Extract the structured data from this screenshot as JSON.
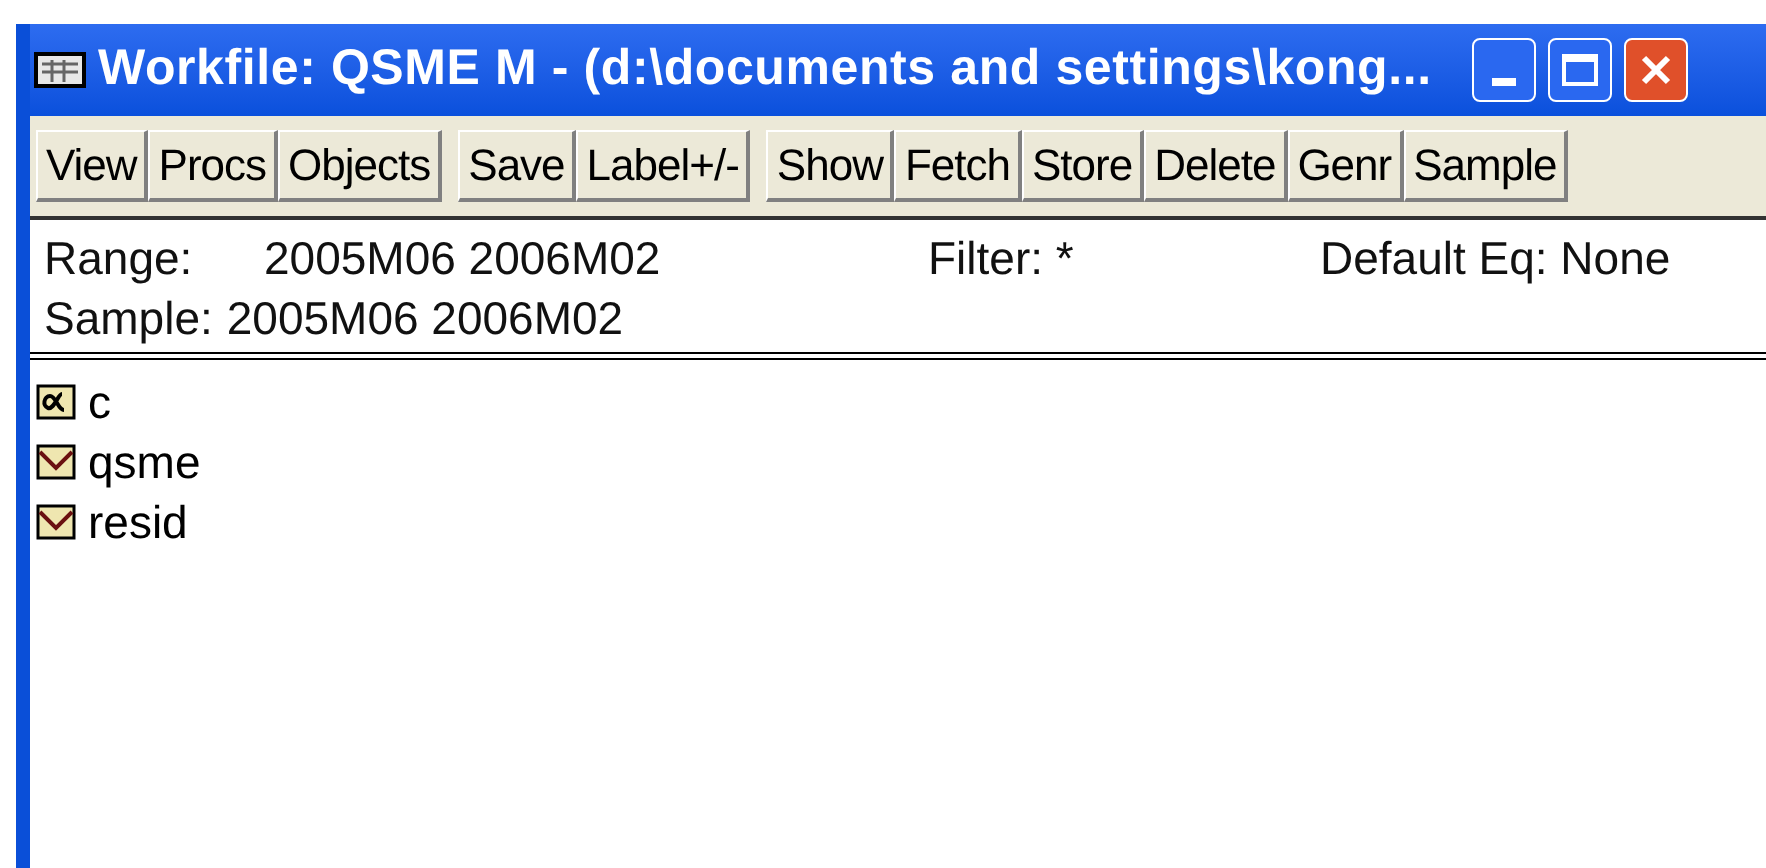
{
  "window": {
    "title": "Workfile: QSME M - (d:\\documents and settings\\kong..."
  },
  "toolbar": [
    [
      "View",
      "Procs",
      "Objects"
    ],
    [
      "Save",
      "Label+/-"
    ],
    [
      "Show",
      "Fetch",
      "Store",
      "Delete",
      "Genr",
      "Sample"
    ]
  ],
  "info": {
    "range_label": "Range:",
    "range": "2005M06 2006M02",
    "filter": "Filter: *",
    "default_eq": "Default Eq: None",
    "sample_label": "Sample:",
    "sample": "2005M06 2006M02"
  },
  "objects": [
    {
      "name": "c",
      "kind": "coef"
    },
    {
      "name": "qsme",
      "kind": "series"
    },
    {
      "name": "resid",
      "kind": "series"
    }
  ]
}
